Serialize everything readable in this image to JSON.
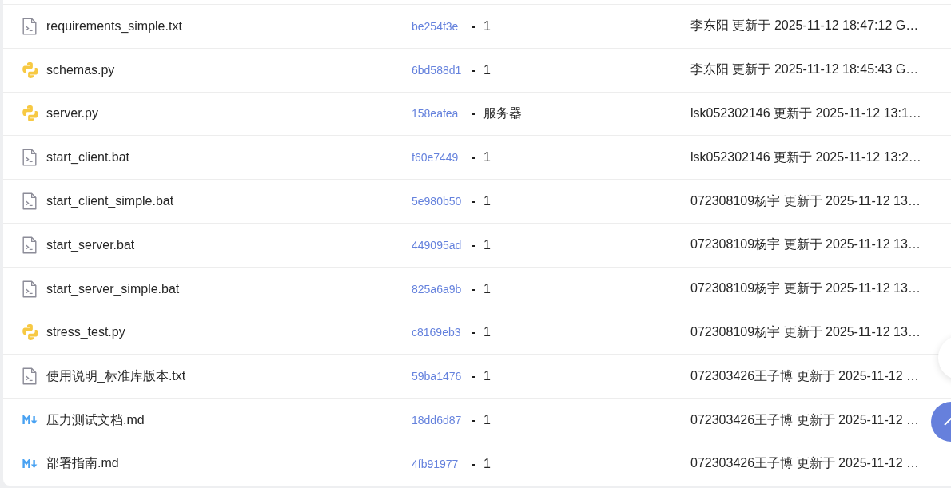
{
  "files": [
    {
      "name": "requirements_simple.txt",
      "kind": "text",
      "commit": "be254f3e",
      "separator": "-",
      "message": "1",
      "updated": "李东阳 更新于 2025-11-12 18:47:12 G…"
    },
    {
      "name": "schemas.py",
      "kind": "python",
      "commit": "6bd588d1",
      "separator": "-",
      "message": "1",
      "updated": "李东阳 更新于 2025-11-12 18:45:43 G…"
    },
    {
      "name": "server.py",
      "kind": "python",
      "commit": "158eafea",
      "separator": "-",
      "message": "服务器",
      "updated": "lsk052302146 更新于 2025-11-12 13:1…"
    },
    {
      "name": "start_client.bat",
      "kind": "text",
      "commit": "f60e7449",
      "separator": "-",
      "message": "1",
      "updated": "lsk052302146 更新于 2025-11-12 13:2…"
    },
    {
      "name": "start_client_simple.bat",
      "kind": "text",
      "commit": "5e980b50",
      "separator": "-",
      "message": "1",
      "updated": "072308109杨宇 更新于 2025-11-12 13…"
    },
    {
      "name": "start_server.bat",
      "kind": "text",
      "commit": "449095ad",
      "separator": "-",
      "message": "1",
      "updated": "072308109杨宇 更新于 2025-11-12 13…"
    },
    {
      "name": "start_server_simple.bat",
      "kind": "text",
      "commit": "825a6a9b",
      "separator": "-",
      "message": "1",
      "updated": "072308109杨宇 更新于 2025-11-12 13…"
    },
    {
      "name": "stress_test.py",
      "kind": "python",
      "commit": "c8169eb3",
      "separator": "-",
      "message": "1",
      "updated": "072308109杨宇 更新于 2025-11-12 13…"
    },
    {
      "name": "使用说明_标准库版本.txt",
      "kind": "text",
      "commit": "59ba1476",
      "separator": "-",
      "message": "1",
      "updated": "072303426王子博 更新于 2025-11-12 …"
    },
    {
      "name": "压力测试文档.md",
      "kind": "markdown",
      "commit": "18dd6d87",
      "separator": "-",
      "message": "1",
      "updated": "072303426王子博 更新于 2025-11-12 …"
    },
    {
      "name": "部署指南.md",
      "kind": "markdown",
      "commit": "4fb91977",
      "separator": "-",
      "message": "1",
      "updated": "072303426王子博 更新于 2025-11-12 …"
    }
  ]
}
